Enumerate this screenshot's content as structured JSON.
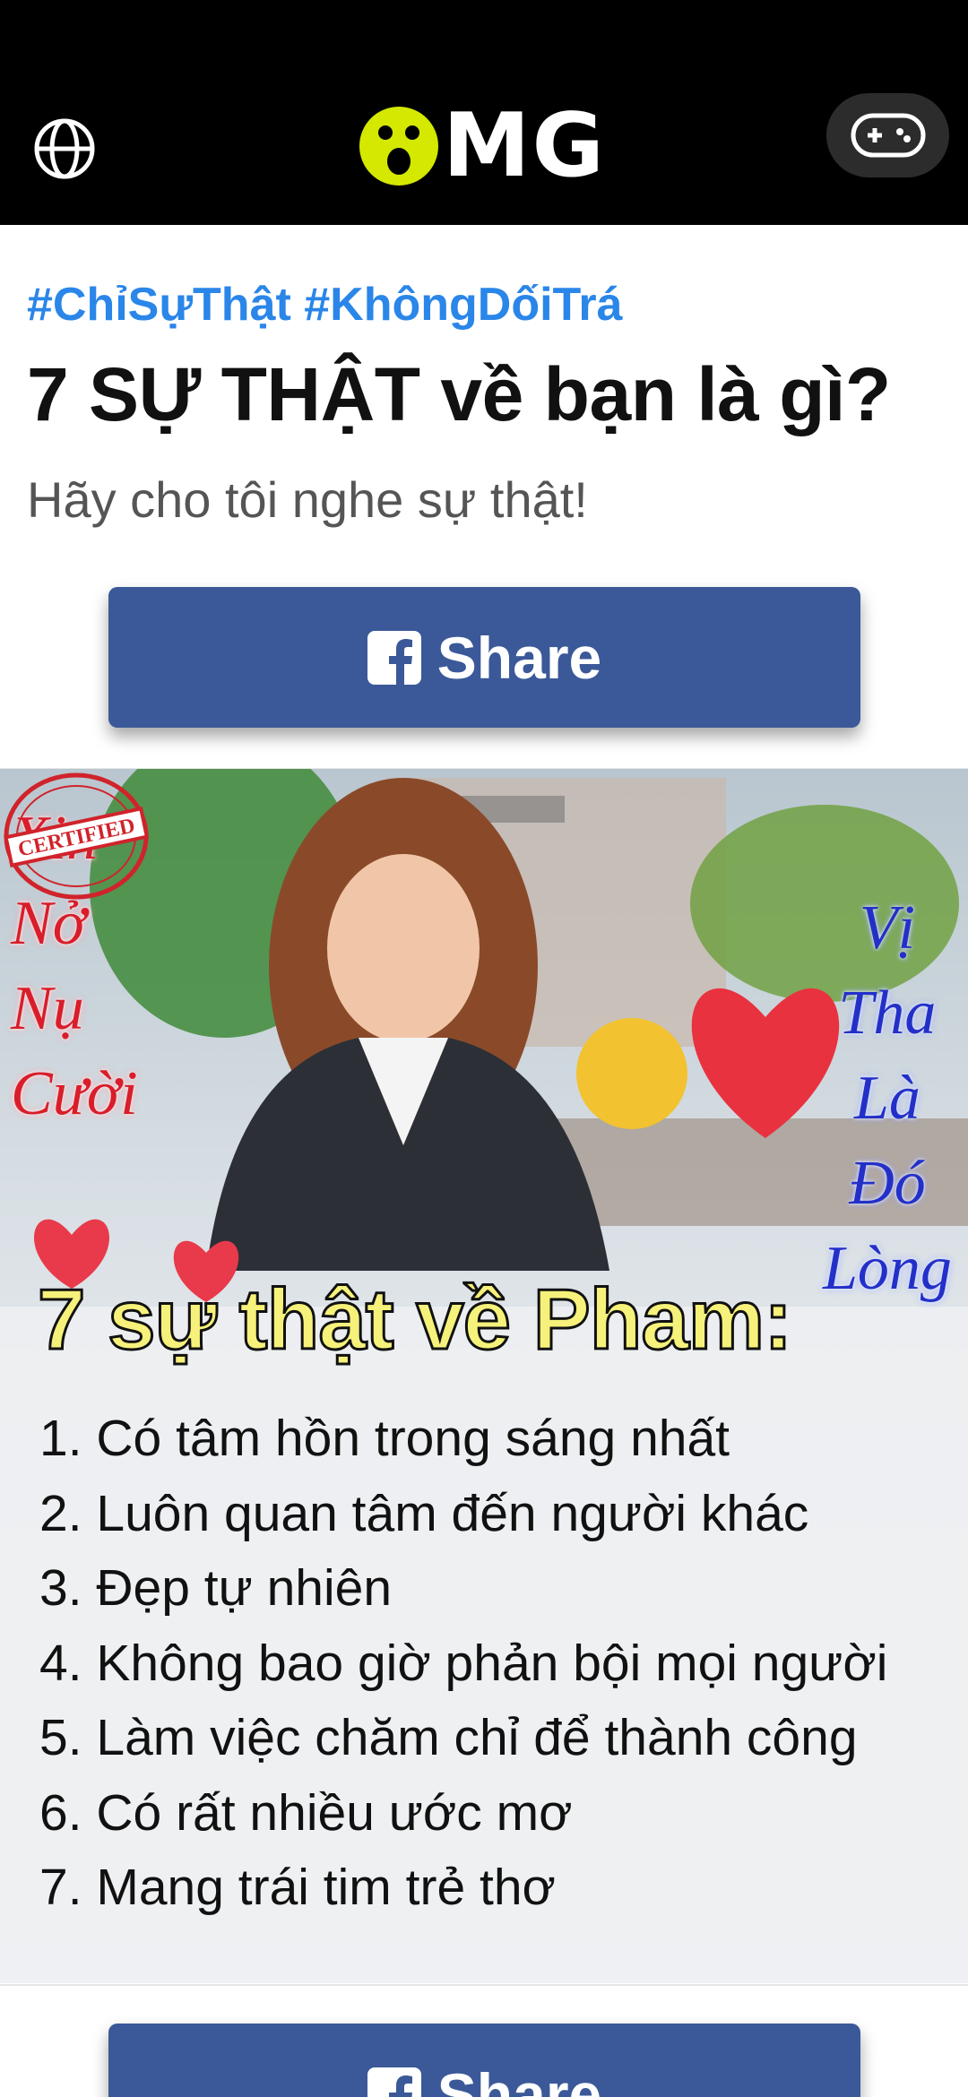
{
  "header": {
    "logo_text": "MG",
    "globe_icon": "globe-icon",
    "game_icon": "gamepad-icon",
    "logo_face_color": "#d4e800"
  },
  "article": {
    "hashtags": "#ChỉSựThật #KhôngDốiTrá",
    "title": "7 SỰ THẬT về bạn là gì?",
    "subtitle": "Hãy cho tôi nghe sự thật!",
    "share_label": "Share"
  },
  "result": {
    "heading": "7 sự thật về Pham:",
    "facts": [
      "1. Có tâm hồn trong sáng nhất",
      "2. Luôn quan tâm đến người khác",
      "3. Đẹp tự nhiên",
      "4. Không bao giờ phản bội mọi người",
      "5. Làm việc chăm chỉ để thành công",
      "6. Có rất nhiều ước mơ",
      "7. Mang trái tim trẻ thơ"
    ],
    "left_script": [
      "Xin",
      "Nở",
      "Nụ",
      "Cười"
    ],
    "right_script": [
      "Vị",
      "Tha",
      "Là",
      "Đó",
      "Lòng"
    ],
    "stamp_text": "CERTIFIED",
    "stamp_color": "#d0232b"
  },
  "colors": {
    "hashtag": "#2a86e8",
    "share_button": "#3b5998",
    "heading_fill": "#f6f17a"
  }
}
